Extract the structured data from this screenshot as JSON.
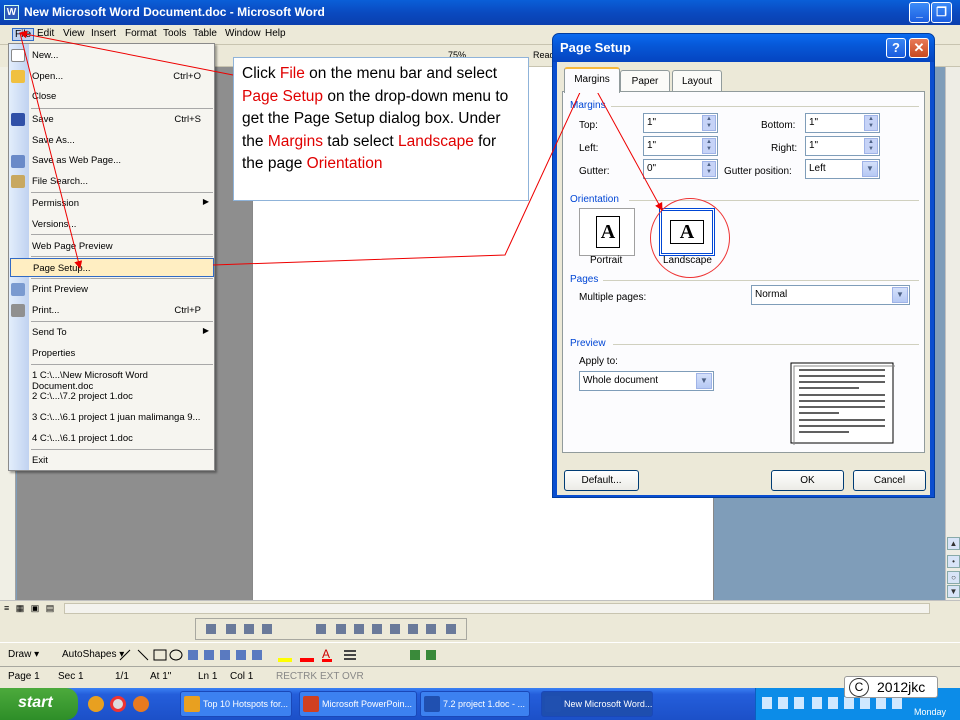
{
  "window": {
    "title": "New Microsoft Word Document.doc - Microsoft Word"
  },
  "menubar": [
    "File",
    "Edit",
    "View",
    "Insert",
    "Format",
    "Tools",
    "Table",
    "Window",
    "Help"
  ],
  "toolbar": {
    "zoom": "75%",
    "read_label": "Read"
  },
  "file_menu": {
    "new": "New...",
    "open": "Open...",
    "open_sc": "Ctrl+O",
    "close": "Close",
    "save": "Save",
    "save_sc": "Ctrl+S",
    "save_as": "Save As...",
    "save_web": "Save as Web Page...",
    "file_search": "File Search...",
    "permission": "Permission",
    "versions": "Versions...",
    "web_preview": "Web Page Preview",
    "page_setup": "Page Setup...",
    "print_preview": "Print Preview",
    "print": "Print...",
    "print_sc": "Ctrl+P",
    "send_to": "Send To",
    "properties": "Properties",
    "recent1": "1 C:\\...\\New Microsoft Word Document.doc",
    "recent2": "2 C:\\...\\7.2 project 1.doc",
    "recent3": "3 C:\\...\\6.1 project 1 juan malimanga 9...",
    "recent4": "4 C:\\...\\6.1 project 1.doc",
    "exit": "Exit"
  },
  "callout": {
    "p1": "Click ",
    "file": "File",
    "p2": " on the menu bar and select ",
    "page_setup": "Page Setup",
    "p3": " on the drop-down menu to get the Page Setup dialog box. Under the ",
    "margins": "Margins",
    "p4": " tab select ",
    "landscape": "Landscape",
    "p5": " for the page ",
    "orientation": "Orientation"
  },
  "dialog": {
    "title": "Page Setup",
    "help": "?",
    "close": "✕",
    "tabs": [
      "Margins",
      "Paper",
      "Layout"
    ],
    "margins_group": "Margins",
    "top_label": "Top:",
    "top_value": "1\"",
    "bottom_label": "Bottom:",
    "bottom_value": "1\"",
    "left_label": "Left:",
    "left_value": "1\"",
    "right_label": "Right:",
    "right_value": "1\"",
    "gutter_label": "Gutter:",
    "gutter_value": "0\"",
    "gutter_pos_label": "Gutter position:",
    "gutter_pos_value": "Left",
    "orientation_group": "Orientation",
    "portrait": "Portrait",
    "landscape": "Landscape",
    "pages_group": "Pages",
    "multiple_pages_label": "Multiple pages:",
    "multiple_pages_value": "Normal",
    "preview_group": "Preview",
    "apply_to_label": "Apply to:",
    "apply_to_value": "Whole document",
    "default_btn": "Default...",
    "ok_btn": "OK",
    "cancel_btn": "Cancel"
  },
  "drawbar": {
    "draw": "Draw ▾",
    "autoshapes": "AutoShapes ▾"
  },
  "status": {
    "page": "Page 1",
    "sec": "Sec 1",
    "pages": "1/1",
    "at": "At 1\"",
    "ln": "Ln 1",
    "col": "Col 1",
    "rec": "REC",
    "trk": "TRK",
    "ext": "EXT",
    "ovr": "OVR"
  },
  "taskbar": {
    "start": "start",
    "tasks": [
      "Top 10 Hotspots for...",
      "Microsoft PowerPoin...",
      "7.2 project 1.doc - ...",
      "New Microsoft Word..."
    ],
    "day": "Monday"
  },
  "credit": {
    "symbol": "C",
    "text": "2012jkc"
  }
}
